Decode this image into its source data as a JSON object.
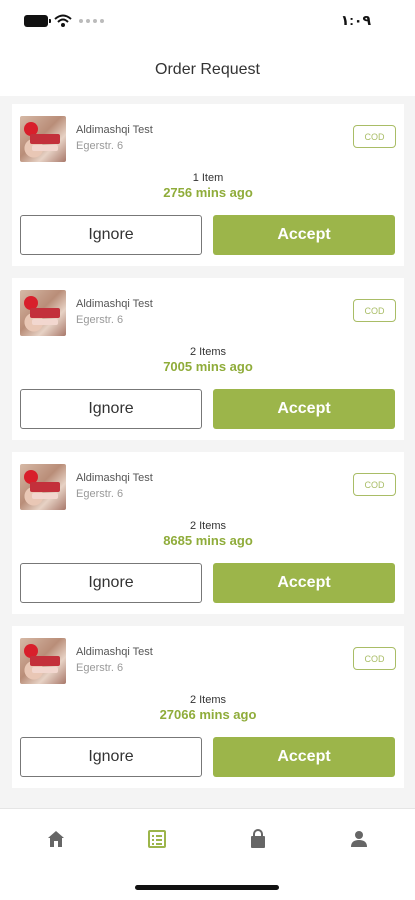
{
  "status_bar": {
    "time": "١:٠٩"
  },
  "header": {
    "title": "Order Request"
  },
  "orders": [
    {
      "store": "Aldimashqi Test",
      "address": "Egerstr. 6",
      "payment": "COD",
      "items": "1 Item",
      "minutes": "2756 mins ago",
      "ignore_label": "Ignore",
      "accept_label": "Accept"
    },
    {
      "store": "Aldimashqi Test",
      "address": "Egerstr. 6",
      "payment": "COD",
      "items": "2 Items",
      "minutes": "7005 mins ago",
      "ignore_label": "Ignore",
      "accept_label": "Accept"
    },
    {
      "store": "Aldimashqi Test",
      "address": "Egerstr. 6",
      "payment": "COD",
      "items": "2 Items",
      "minutes": "8685 mins ago",
      "ignore_label": "Ignore",
      "accept_label": "Accept"
    },
    {
      "store": "Aldimashqi Test",
      "address": "Egerstr. 6",
      "payment": "COD",
      "items": "2 Items",
      "minutes": "27066 mins ago",
      "ignore_label": "Ignore",
      "accept_label": "Accept"
    }
  ],
  "tabbar": {
    "items": [
      {
        "icon": "home-icon",
        "active": false
      },
      {
        "icon": "order-list-icon",
        "active": true
      },
      {
        "icon": "shopping-bag-icon",
        "active": false
      },
      {
        "icon": "user-icon",
        "active": false
      }
    ],
    "active_color": "#9cb54a",
    "inactive_color": "#666666"
  },
  "colors": {
    "accent": "#9cb54a",
    "accent_text": "#8fac3a",
    "cod_border": "#a9bd66"
  }
}
